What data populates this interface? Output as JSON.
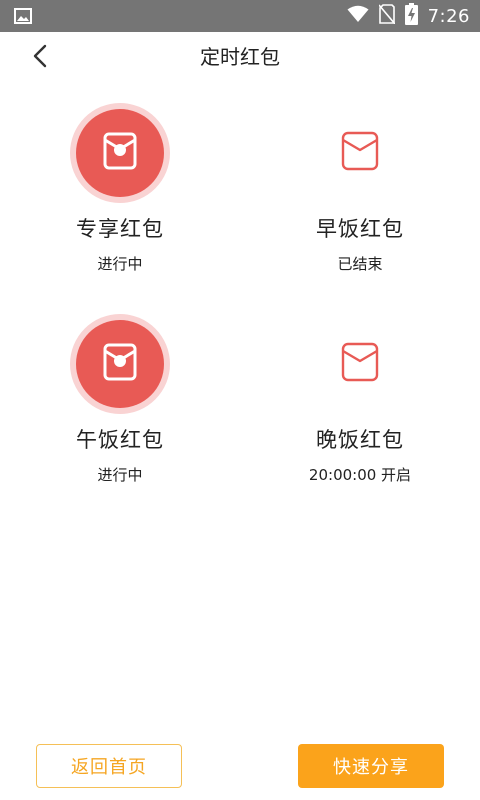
{
  "status_bar": {
    "time": "7:26",
    "icons": [
      "image-icon",
      "wifi-icon",
      "no-sim-icon",
      "battery-charging-icon"
    ]
  },
  "nav": {
    "title": "定时红包",
    "back_icon": "chevron-left-icon"
  },
  "packets": [
    {
      "name": "专享红包",
      "status": "进行中",
      "active": true
    },
    {
      "name": "早饭红包",
      "status": "已结束",
      "active": false
    },
    {
      "name": "午饭红包",
      "status": "进行中",
      "active": true
    },
    {
      "name": "晚饭红包",
      "status": "20:00:00 开启",
      "active": false
    }
  ],
  "footer": {
    "home_label": "返回首页",
    "share_label": "快速分享"
  },
  "colors": {
    "status_bar_bg": "#757575",
    "red_accent": "#e85a55",
    "red_halo": "#f9d3d3",
    "orange_primary": "#fba31b",
    "orange_outline": "#f5c057"
  }
}
